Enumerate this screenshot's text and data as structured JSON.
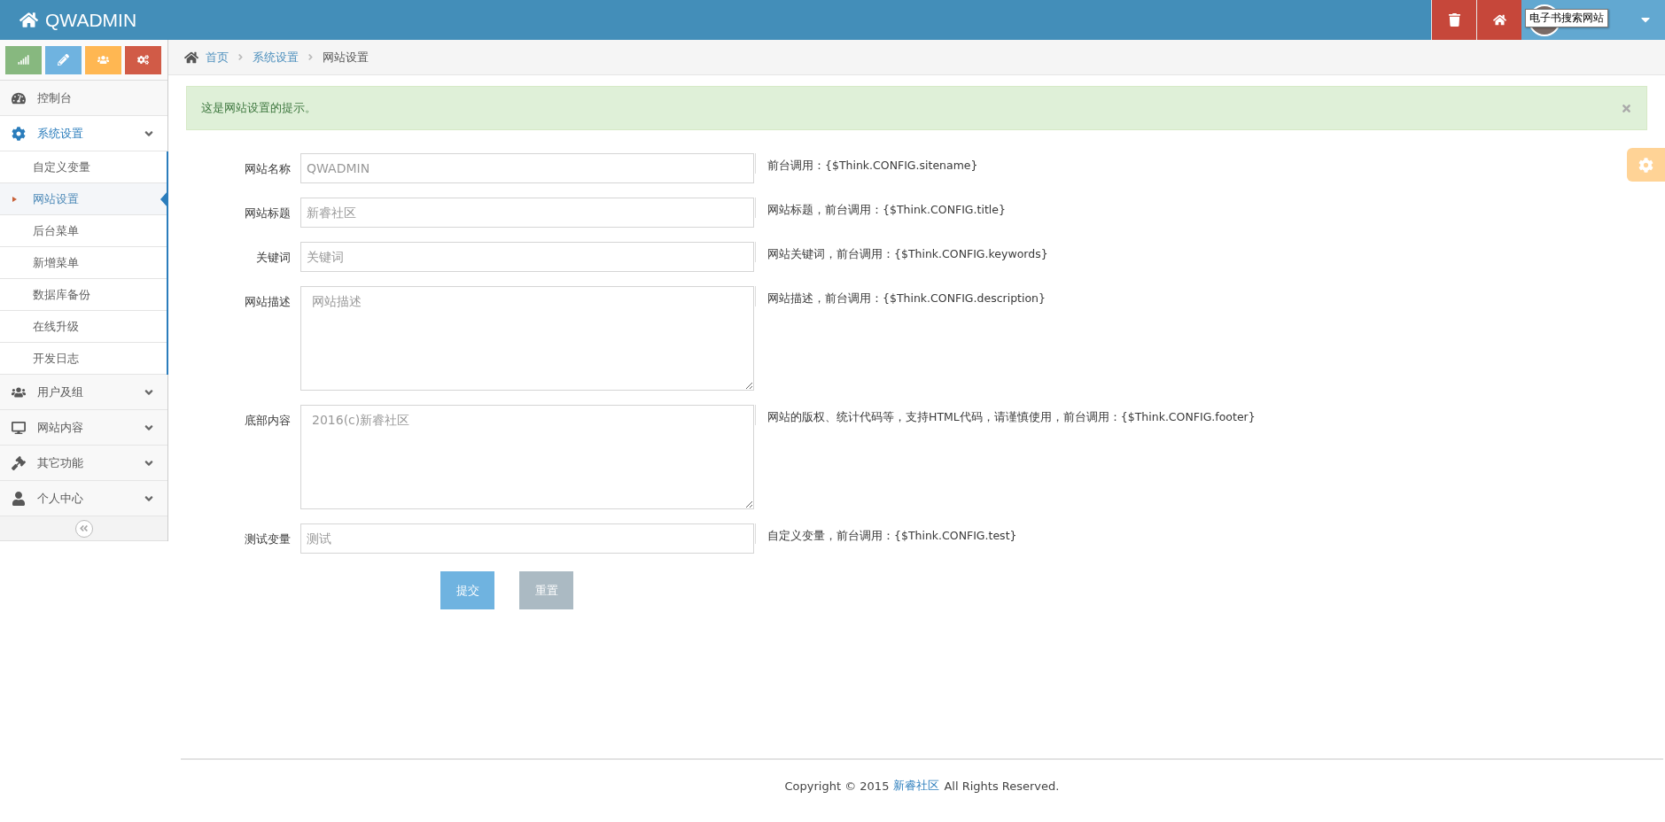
{
  "header": {
    "brand": "QWADMIN",
    "tooltip": "电子书搜索网站"
  },
  "shortcuts": [
    {
      "kind": "signal",
      "color": "#87b87f"
    },
    {
      "kind": "pencil",
      "color": "#6fb3e0"
    },
    {
      "kind": "users",
      "color": "#ffb752"
    },
    {
      "kind": "cogs",
      "color": "#d15b47"
    }
  ],
  "sidebar": {
    "items": [
      {
        "kind": "dashboard",
        "label": "控制台",
        "expanded": false,
        "has_children": false
      },
      {
        "kind": "cog",
        "label": "系统设置",
        "expanded": true,
        "has_children": true,
        "children": [
          {
            "label": "自定义变量",
            "selected": false
          },
          {
            "label": "网站设置",
            "selected": true
          },
          {
            "label": "后台菜单",
            "selected": false
          },
          {
            "label": "新增菜单",
            "selected": false
          },
          {
            "label": "数据库备份",
            "selected": false
          },
          {
            "label": "在线升级",
            "selected": false
          },
          {
            "label": "开发日志",
            "selected": false
          }
        ]
      },
      {
        "kind": "users",
        "label": "用户及组",
        "expanded": false,
        "has_children": true
      },
      {
        "kind": "desktop",
        "label": "网站内容",
        "expanded": false,
        "has_children": true
      },
      {
        "kind": "gavel",
        "label": "其它功能",
        "expanded": false,
        "has_children": true
      },
      {
        "kind": "user",
        "label": "个人中心",
        "expanded": false,
        "has_children": true
      }
    ]
  },
  "breadcrumb": [
    {
      "label": "首页",
      "active": false
    },
    {
      "label": "系统设置",
      "active": false
    },
    {
      "label": "网站设置",
      "active": true
    }
  ],
  "alert": {
    "text": "这是网站设置的提示。"
  },
  "form": {
    "fields": [
      {
        "kind": "input",
        "label": "网站名称",
        "placeholder": "QWADMIN",
        "help": "前台调用：{$Think.CONFIG.sitename}"
      },
      {
        "kind": "input",
        "label": "网站标题",
        "placeholder": "新睿社区",
        "help": "网站标题，前台调用：{$Think.CONFIG.title}"
      },
      {
        "kind": "input",
        "label": "关键词",
        "placeholder": "关键词",
        "help": "网站关键词，前台调用：{$Think.CONFIG.keywords}"
      },
      {
        "kind": "textarea",
        "label": "网站描述",
        "placeholder": "网站描述",
        "help": "网站描述，前台调用：{$Think.CONFIG.description}"
      },
      {
        "kind": "textarea",
        "label": "底部内容",
        "placeholder": "2016(c)新睿社区",
        "help": "网站的版权、统计代码等，支持HTML代码，请谨慎使用，前台调用：{$Think.CONFIG.footer}"
      },
      {
        "kind": "input",
        "label": "测试变量",
        "placeholder": "测试",
        "help": "自定义变量，前台调用：{$Think.CONFIG.test}"
      }
    ],
    "buttons": [
      {
        "kind": "primary",
        "label": "提交"
      },
      {
        "kind": "secondary",
        "label": "重置"
      }
    ]
  },
  "footer": {
    "before": "Copyright © 2015",
    "link": "新睿社区",
    "after": "All Rights Reserved."
  }
}
